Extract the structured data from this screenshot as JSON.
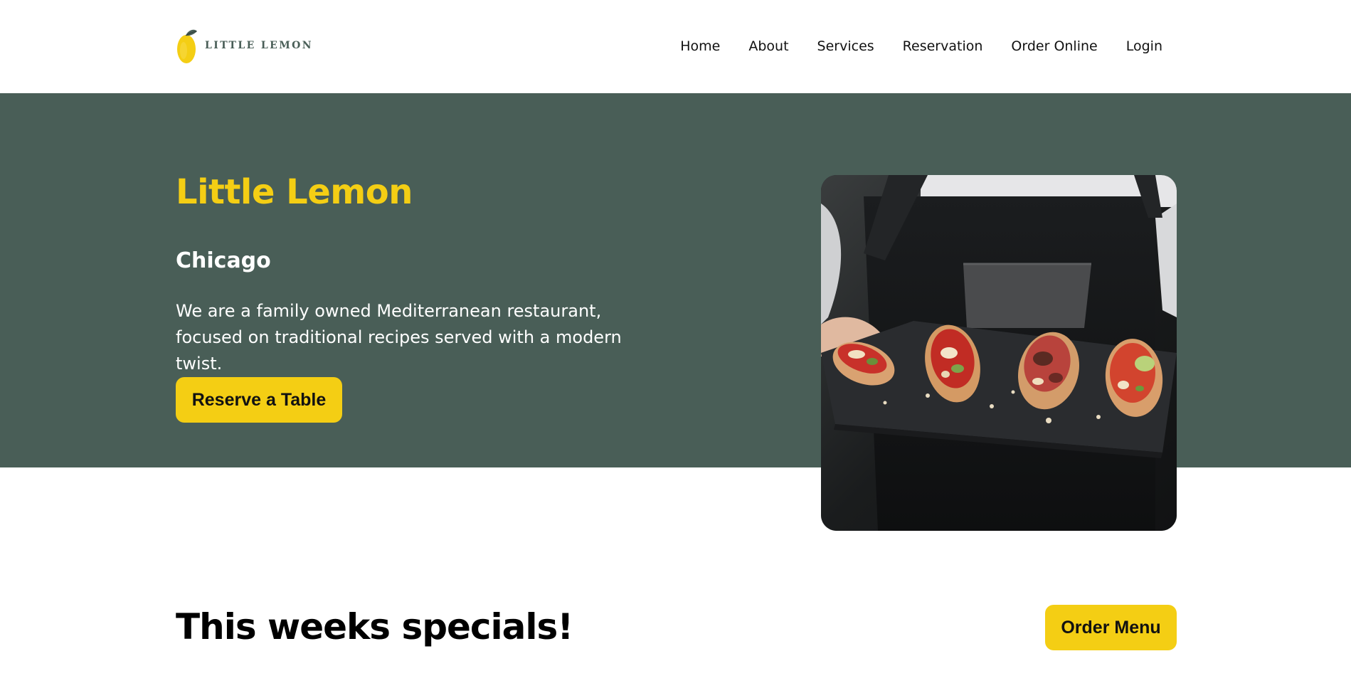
{
  "brand": {
    "name": "LITTLE LEMON",
    "colors": {
      "primary": "#495e57",
      "accent": "#f4ce14"
    }
  },
  "nav": {
    "items": [
      {
        "label": "Home"
      },
      {
        "label": "About"
      },
      {
        "label": "Services"
      },
      {
        "label": "Reservation"
      },
      {
        "label": "Order Online"
      },
      {
        "label": "Login"
      }
    ]
  },
  "hero": {
    "title": "Little Lemon",
    "subtitle": "Chicago",
    "description": "We are a family owned Mediterranean restaurant, focused on traditional recipes served with a modern twist.",
    "cta_label": "Reserve a Table",
    "image_icon": "food-photo"
  },
  "specials": {
    "title": "This weeks specials!",
    "button_label": "Order Menu"
  }
}
